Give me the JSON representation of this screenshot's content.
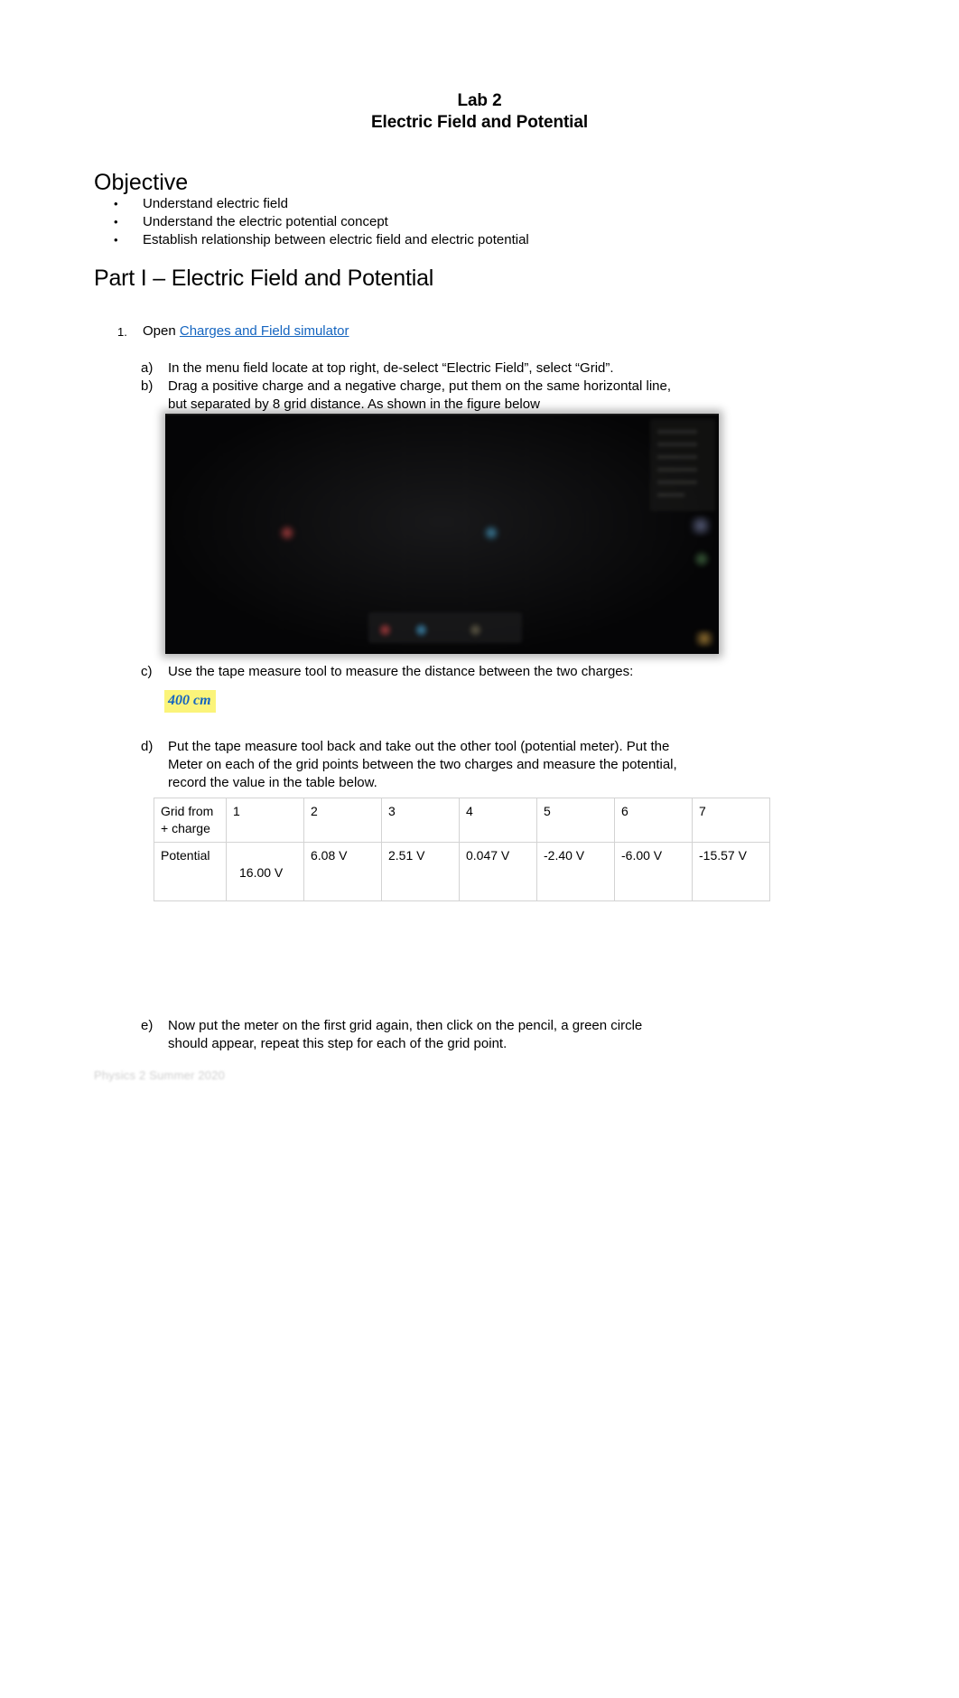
{
  "document": {
    "title_line1": "Lab 2",
    "title_line2": "Electric Field and Potential",
    "footer_note": "Physics 2 Summer 2020"
  },
  "objective": {
    "heading": "Objective",
    "bullets": [
      "Understand electric field",
      "Understand the electric potential concept",
      "Establish relationship between electric field and electric potential"
    ]
  },
  "part1": {
    "heading": "Part I – Electric Field and Potential",
    "step1": {
      "number": "1.",
      "text_before_link": "Open ",
      "link_text": "Charges and Field simulator"
    },
    "sub_items": {
      "a": {
        "mark": "a)",
        "line1": "In the menu field locate at top right, de-select “Electric Field”, select “Grid”."
      },
      "b": {
        "mark": "b)",
        "line1": "Drag a positive charge and a negative charge, put them on the same horizontal line,",
        "line2": "but separated by 8 grid distance.  As shown in the figure below"
      },
      "c": {
        "mark": "c)",
        "line1": "Use the tape measure tool to measure the distance between the two charges:",
        "answer": "400 cm",
        "answer_color": "#1565c0",
        "highlight_color": "#fbf47a"
      },
      "d": {
        "mark": "d)",
        "line1": "Put the tape measure tool back and take out the other tool (potential meter).  Put the",
        "line2": "Meter on each of the grid points between the two charges and measure the potential,",
        "line3": "record the value in the table below."
      },
      "e": {
        "mark": "e)",
        "line1": "Now put the meter on the first grid again, then click on the pencil, a green circle",
        "line2": "should appear, repeat this step for each of the grid point."
      }
    },
    "figure": {
      "alt_name": "charges-and-fields-simulator-screenshot"
    },
    "table": {
      "row_labels": {
        "grid_label_line1": "Grid from",
        "grid_label_line2": "+ charge",
        "potential_label": "Potential"
      },
      "grid_numbers": [
        "1",
        "2",
        "3",
        "4",
        "5",
        "6",
        "7"
      ],
      "potentials": [
        "16.00 V",
        "6.08 V",
        "2.51 V",
        "0.047 V",
        "-2.40 V",
        "-6.00 V",
        "-15.57 V"
      ]
    }
  }
}
